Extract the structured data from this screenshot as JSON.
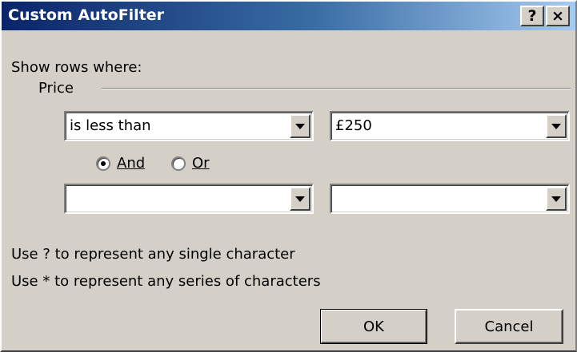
{
  "window": {
    "title": "Custom AutoFilter",
    "help_label": "?",
    "close_label": "×"
  },
  "filter": {
    "show_rows_label": "Show rows where:",
    "group_label": "Price",
    "condition1": {
      "operator": "is less than",
      "value": "£250"
    },
    "condition2": {
      "operator": "",
      "value": ""
    },
    "and_label": "And",
    "or_label": "Or",
    "selected_logic": "And"
  },
  "hints": {
    "single_char": "Use ? to represent any single character",
    "series_chars": "Use * to represent any series of characters"
  },
  "buttons": {
    "ok_label": "OK",
    "cancel_label": "Cancel"
  }
}
